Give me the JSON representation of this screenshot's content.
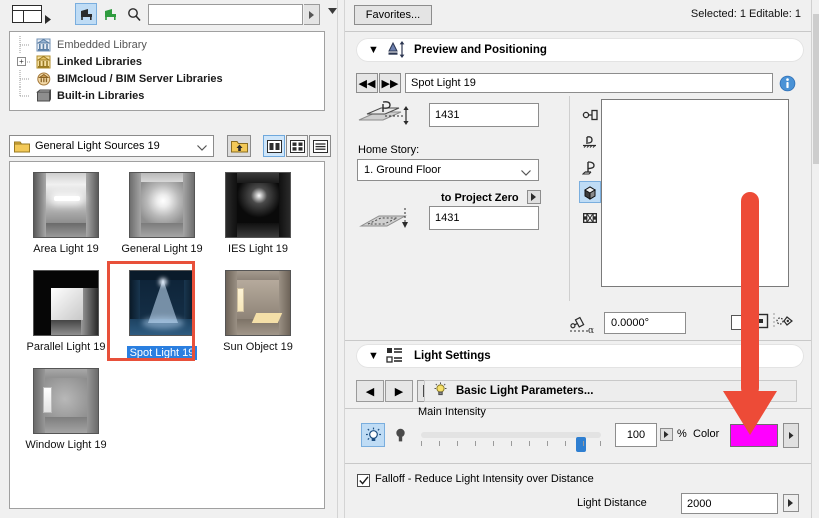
{
  "left_panel": {
    "toolbar": {
      "browser_button": "library-browser",
      "furniture_active": "furniture-blue-icon",
      "furniture_inactive": "furniture-green-icon",
      "search_icon": "search-icon",
      "search_value": "",
      "search_placeholder": "",
      "go_arrow": "▶"
    },
    "tree": {
      "items": [
        {
          "label": "Embedded Library",
          "bold": false,
          "expandable": false,
          "icon": "embedded-library-icon"
        },
        {
          "label": "Linked Libraries",
          "bold": true,
          "expandable": true,
          "expander": "+",
          "icon": "linked-library-icon"
        },
        {
          "label": "BIMcloud / BIM Server Libraries",
          "bold": true,
          "expandable": false,
          "icon": "bimcloud-library-icon"
        },
        {
          "label": "Built-in Libraries",
          "bold": true,
          "expandable": false,
          "icon": "builtin-library-icon"
        }
      ]
    },
    "folder_bar": {
      "selected_folder": "General Light Sources 19",
      "up_button": "folder-up",
      "view_large": "large-icons-view",
      "view_small": "small-icons-view",
      "view_list": "list-view"
    },
    "thumbnails": [
      {
        "label": "Area Light 19",
        "art": "area",
        "selected": false
      },
      {
        "label": "General Light 19",
        "art": "general",
        "selected": false
      },
      {
        "label": "IES Light 19",
        "art": "ies",
        "selected": false
      },
      {
        "label": "Parallel Light 19",
        "art": "parallel",
        "selected": false
      },
      {
        "label": "Spot Light 19",
        "art": "spot",
        "selected": true
      },
      {
        "label": "Sun Object 19",
        "art": "sun",
        "selected": false
      },
      {
        "label": "Window Light 19",
        "art": "window",
        "selected": false
      }
    ]
  },
  "right_panel": {
    "favorites_label": "Favorites...",
    "status": "Selected: 1 Editable: 1",
    "preview_section": {
      "title": "Preview and Positioning",
      "triangle": "▼",
      "object_name": "Spot Light 19",
      "prev_label": "◀◀",
      "next_label": "▶▶",
      "info_label": "i",
      "elevation_value": "1431",
      "home_story_label": "Home Story:",
      "home_story_value": "1. Ground Floor",
      "to_project_zero_label": "to Project Zero",
      "project_zero_value": "1431",
      "angle_value": "0.0000°",
      "view_icons": [
        "2d-symbol-view-icon",
        "front-view-icon",
        "side-view-icon",
        "3d-view-icon",
        "film-preview-icon"
      ],
      "active_view_index": 3
    },
    "light_settings": {
      "title": "Light Settings",
      "triangle": "▼",
      "params_button": "Basic Light Parameters...",
      "prev_label": "◀",
      "next_label": "▶",
      "intensity_label": "Main Intensity",
      "intensity_value": "100",
      "percent_sign": "%",
      "color_label": "Color",
      "color_value": "#FF00FF",
      "falloff_label": "Falloff - Reduce Light Intensity over Distance",
      "falloff_checked": true,
      "light_distance_label": "Light Distance",
      "light_distance_value": "2000"
    }
  },
  "annotation": {
    "arrow_color": "#ED4B37",
    "points_to": "color-swatch"
  }
}
